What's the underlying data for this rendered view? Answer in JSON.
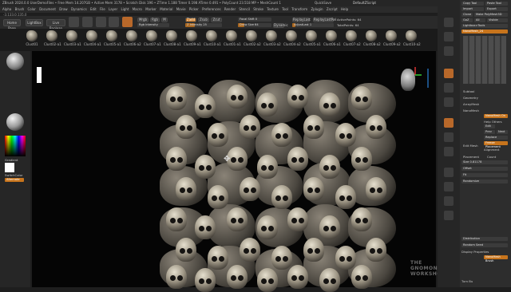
{
  "title_bar": {
    "title": "ZBrush 2024.0.0 UserDemoFiles • Free Mem 14.207GB • Active Mem 3178 • Scratch Disk 196 • ZTime 1.188 Timer 0.198 ATime 0.491 • PolyCount 23.518 MP • MeshCount 1",
    "quicksave": "QuickSave",
    "default_script": "DefaultZScript"
  },
  "menu": [
    "Alpha",
    "Brush",
    "Color",
    "Document",
    "Draw",
    "Dynamics",
    "Edit",
    "File",
    "Layer",
    "Light",
    "Macro",
    "Marker",
    "Material",
    "Movie",
    "Picker",
    "Preferences",
    "Render",
    "Stencil",
    "Stroke",
    "Texture",
    "Tool",
    "Transform",
    "Zplugin",
    "Zscript",
    "Help"
  ],
  "coords": "-3.133,0.135,0",
  "shelf": {
    "home_page": "Home Page",
    "lightbox": "LightBox",
    "live_boolean": "Live Boolean",
    "mrgb": "Mrgb",
    "rgb": "Rgb",
    "m": "M",
    "zadd": "Zadd",
    "zsub": "Zsub",
    "zcut": "Zcut",
    "rgb_intensity": "Rgb Intensity",
    "z_intensity": "Z Intensity 25",
    "focal_shift": "Focal Shift 0",
    "draw_size": "Draw Size 64",
    "dynamic": "Dynamic",
    "replay_last": "ReplayLast",
    "replay_last_rel": "ReplayLastRel",
    "active_points": "ActivePoints: 64",
    "total_points": "TotalPoints: 64",
    "adjust_last": "AdjustLast 1"
  },
  "brushes": [
    "Clust01",
    "Clust02-a1",
    "Clust03-a1",
    "Clust04-a1",
    "Clust05-a1",
    "Clust06-a2",
    "Clust07-a1",
    "Clust08-a1",
    "Clust09-a1",
    "Clust10-a1",
    "Clust01-a1",
    "Clust02-a2",
    "Clust03-a2",
    "Clust04-a2",
    "Clust05-a1",
    "Clust06-a1",
    "Clust07-a2",
    "Clust08-a2",
    "Clust09-a2",
    "Clust10-a2"
  ],
  "left_panel": {
    "gradient": "Gradient",
    "switch_color": "SwitchColor",
    "alternate": "Alternate"
  },
  "right_panel": {
    "copy_tool": "Copy Tool",
    "paste_tool": "Paste Tool",
    "import": "Import",
    "export": "Export",
    "clone": "Clone",
    "make_polymesh": "Make PolyMesh3D",
    "goz": "GoZ",
    "all": "All",
    "visible": "Visible",
    "lightbox_tools": "Lightbox>Tools",
    "current_tool": "NanoMesh_24",
    "subtool": "Subtool",
    "geometry": "Geometry",
    "array_mesh": "ArrayMesh",
    "nano_mesh": "NanoMesh",
    "nanomesh_on": "NanoMesh On",
    "help_others": "Help Others",
    "edit": "Edit",
    "prev": "Prev",
    "next": "Next",
    "replace": "Replace",
    "edit_mesh": "Edit Mesh",
    "alignment": "Alignment",
    "freeze_placement": "Freeze Placement",
    "placement": "Placement",
    "count": "Count",
    "size": "Size 0.81178",
    "offset": "Offset",
    "fit": "Fit",
    "randomize": "Randomize",
    "distribution": "Distribution",
    "random_seed": "Random Seed",
    "display_properties": "Display Properties",
    "nanomesh_brush": "NanoMesh Brush",
    "turn_bu": "Turn Bu"
  },
  "watermark": "THE GNOMON WORKSHOP",
  "colors": {
    "accent": "#c7741c",
    "panel": "#2d2d2d",
    "viewport": "#050505"
  }
}
